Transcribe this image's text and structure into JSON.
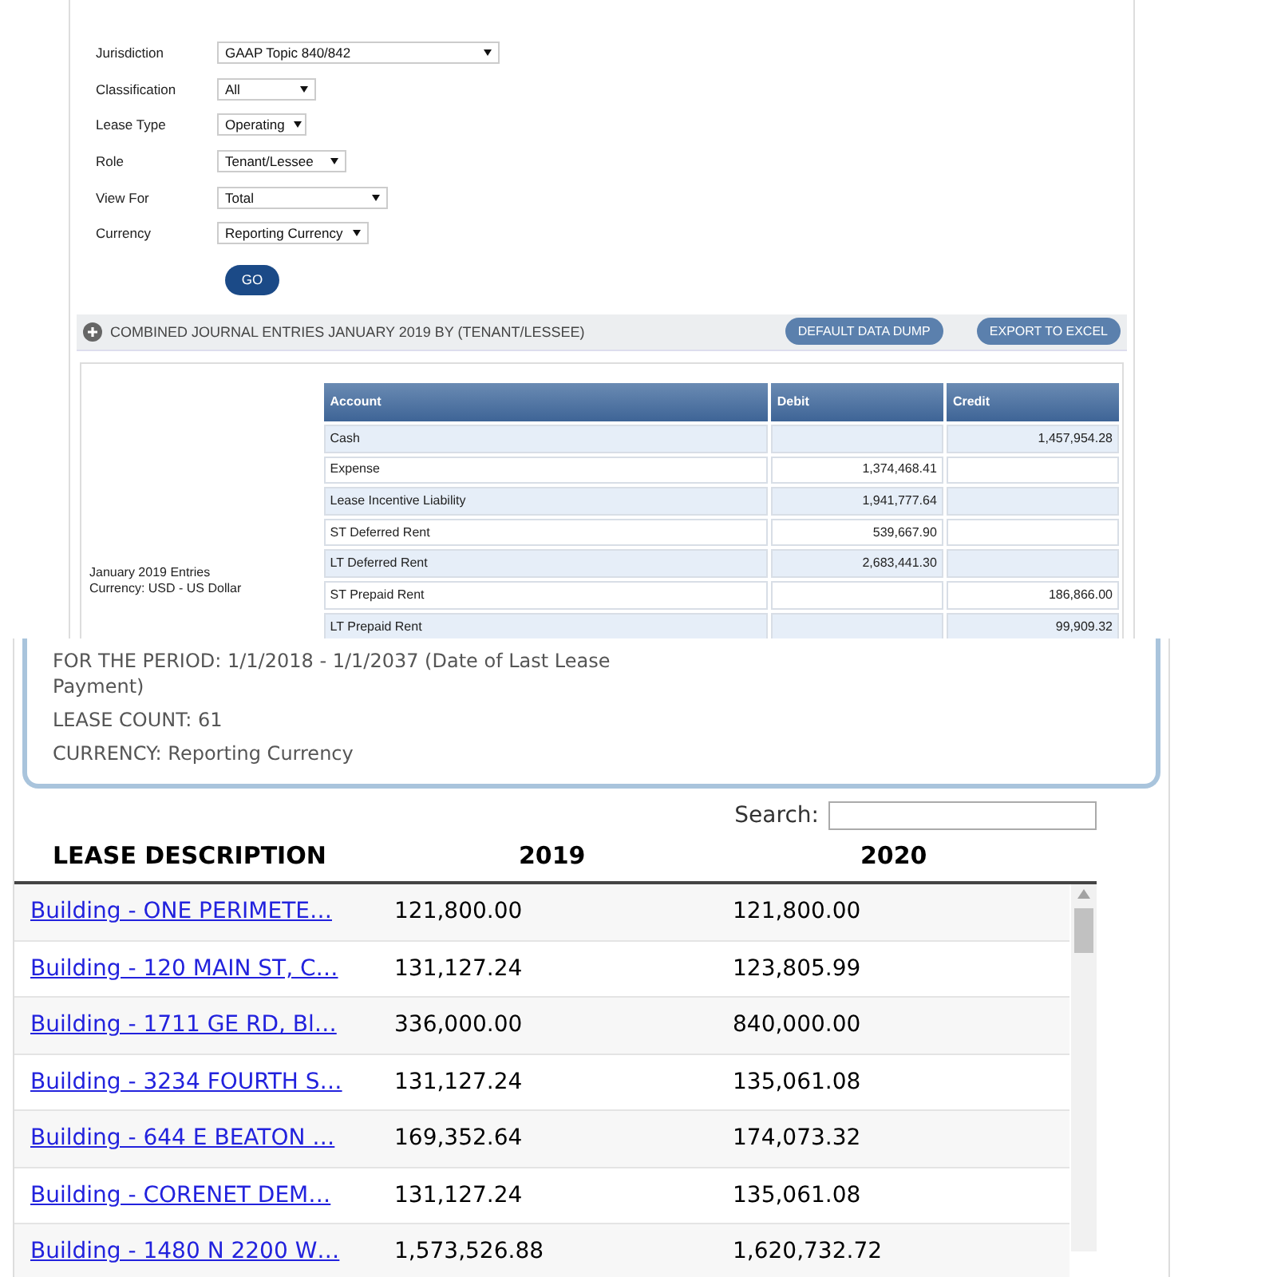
{
  "filters": [
    {
      "label": "Jurisdiction",
      "value": "GAAP Topic 840/842"
    },
    {
      "label": "Classification",
      "value": "All"
    },
    {
      "label": "Lease Type",
      "value": "Operating"
    },
    {
      "label": "Role",
      "value": "Tenant/Lessee"
    },
    {
      "label": "View For",
      "value": "Total"
    },
    {
      "label": "Currency",
      "value": "Reporting Currency"
    }
  ],
  "go_button": "GO",
  "section": {
    "title": "COMBINED JOURNAL ENTRIES JANUARY 2019 BY (TENANT/LESSEE)",
    "buttons": [
      "DEFAULT DATA DUMP",
      "EXPORT TO EXCEL"
    ]
  },
  "entries": {
    "caption": [
      "January 2019 Entries",
      "Currency: USD - US Dollar"
    ],
    "columns": [
      "Account",
      "Debit",
      "Credit"
    ],
    "rows": [
      {
        "account": "Cash",
        "debit": "",
        "credit": "1,457,954.28"
      },
      {
        "account": "Expense",
        "debit": "1,374,468.41",
        "credit": ""
      },
      {
        "account": "Lease Incentive Liability",
        "debit": "1,941,777.64",
        "credit": ""
      },
      {
        "account": "ST Deferred Rent",
        "debit": "539,667.90",
        "credit": ""
      },
      {
        "account": "LT Deferred Rent",
        "debit": "2,683,441.30",
        "credit": ""
      },
      {
        "account": "ST Prepaid Rent",
        "debit": "",
        "credit": "186,866.00"
      },
      {
        "account": "LT Prepaid Rent",
        "debit": "",
        "credit": "99,909.32"
      }
    ]
  },
  "summary": [
    "FOR THE PERIOD: 1/1/2018 - 1/1/2037  (Date of Last Lease Payment)",
    "LEASE COUNT: 61",
    "CURRENCY: Reporting Currency"
  ],
  "search": {
    "label": "Search:"
  },
  "leases": {
    "columns": [
      "LEASE DESCRIPTION",
      "2019",
      "2020"
    ],
    "rows": [
      {
        "description": "Building - ONE PERIMETE…",
        "y2019": "121,800.00",
        "y2020": "121,800.00"
      },
      {
        "description": "Building - 120 MAIN ST, C…",
        "y2019": "131,127.24",
        "y2020": "123,805.99"
      },
      {
        "description": "Building - 1711 GE RD, Bl…",
        "y2019": "336,000.00",
        "y2020": "840,000.00"
      },
      {
        "description": "Building - 3234 FOURTH S…",
        "y2019": "131,127.24",
        "y2020": "135,061.08"
      },
      {
        "description": "Building - 644 E BEATON …",
        "y2019": "169,352.64",
        "y2020": "174,073.32"
      },
      {
        "description": "Building - CORENET DEM…",
        "y2019": "131,127.24",
        "y2020": "135,061.08"
      },
      {
        "description": "Building - 1480 N 2200 W…",
        "y2019": "1,573,526.88",
        "y2020": "1,620,732.72"
      }
    ]
  }
}
